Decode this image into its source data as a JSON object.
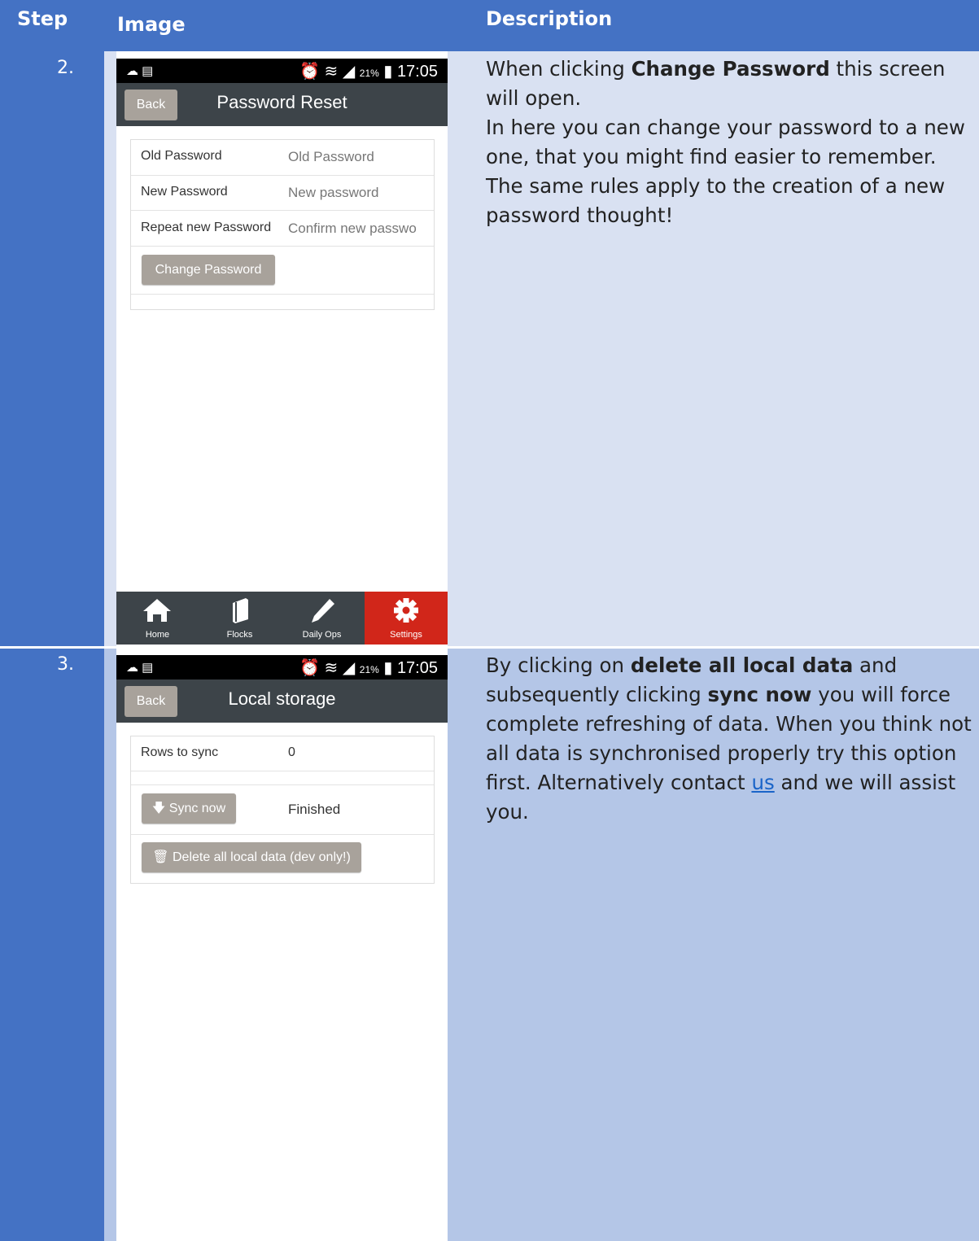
{
  "header": {
    "step": "Step",
    "image": "Image",
    "description": "Description"
  },
  "steps": [
    {
      "number": "2.",
      "phone": {
        "status_icons_left": "☁ ▤",
        "status_icons_right": "⏰ ≋ ◢",
        "battery_pct": "21%",
        "time": "17:05",
        "back_label": "Back",
        "title": "Password Reset",
        "fields": [
          {
            "label": "Old Password",
            "placeholder": "Old Password"
          },
          {
            "label": "New Password",
            "placeholder": "New password"
          },
          {
            "label": "Repeat new Password",
            "placeholder": "Confirm new passwo"
          }
        ],
        "change_button": "Change Password",
        "tabs": [
          {
            "label": "Home",
            "icon": "home-icon"
          },
          {
            "label": "Flocks",
            "icon": "flocks-icon"
          },
          {
            "label": "Daily Ops",
            "icon": "pencil-icon"
          },
          {
            "label": "Settings",
            "icon": "gear-icon"
          }
        ]
      },
      "desc": {
        "p1_a": "When clicking ",
        "p1_b": "Change Password",
        "p1_c": " this screen will open.",
        "p2": "In here you can change your password to a new one, that you might find easier to remember. The same rules apply to the creation of a new password thought!"
      }
    },
    {
      "number": "3.",
      "phone": {
        "status_icons_left": "☁ ▤",
        "status_icons_right": "⏰ ≋ ◢",
        "battery_pct": "21%",
        "time": "17:05",
        "back_label": "Back",
        "title": "Local storage",
        "rows_label": "Rows to sync",
        "rows_value": "0",
        "sync_button": "Sync now",
        "sync_status": "Finished",
        "delete_button": "Delete all local data (dev only!)"
      },
      "desc": {
        "a": "By clicking on ",
        "b": "delete all local data",
        "c": " and subsequently clicking ",
        "d": "sync now",
        "e": " you will force complete refreshing of data. When you think not all data is synchronised properly try this option first. Alternatively contact ",
        "link": "us",
        "f": " and we will assist you."
      }
    }
  ],
  "colors": {
    "header": "#4472c4",
    "row2_desc": "#d9e1f2",
    "row3_desc": "#b4c6e7",
    "active_tab": "#d1261a",
    "appbar": "#3d4449"
  }
}
